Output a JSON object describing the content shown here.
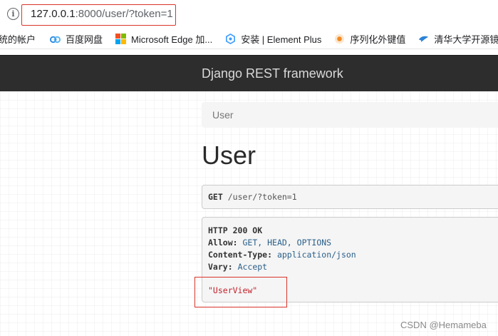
{
  "browser": {
    "url_host": "127.0.0.1",
    "url_rest": ":8000/user/?token=1"
  },
  "bookmarks": [
    {
      "label": "统的帐户",
      "icon": "account-icon"
    },
    {
      "label": "百度网盘",
      "icon": "baidu-netdisk-icon"
    },
    {
      "label": "Microsoft Edge 加...",
      "icon": "microsoft-icon"
    },
    {
      "label": "安装 | Element Plus",
      "icon": "element-plus-icon"
    },
    {
      "label": "序列化外键值",
      "icon": "orange-star-icon"
    },
    {
      "label": "清华大学开源镜像",
      "icon": "bird-icon"
    },
    {
      "label": "",
      "icon": "red-g-icon"
    }
  ],
  "navbar": {
    "brand": "Django REST framework"
  },
  "breadcrumb": {
    "current": "User"
  },
  "page": {
    "title": "User"
  },
  "request": {
    "method": "GET",
    "path": "/user/?token=1"
  },
  "response": {
    "status": "HTTP 200 OK",
    "headers": [
      {
        "key": "Allow:",
        "value": "GET, HEAD, OPTIONS"
      },
      {
        "key": "Content-Type:",
        "value": "application/json"
      },
      {
        "key": "Vary:",
        "value": "Accept"
      }
    ],
    "body": "\"UserView\""
  },
  "watermark": "CSDN @Hemameba",
  "colors": {
    "navbar_bg": "#2d2d2d",
    "annotation_red": "#d9342b",
    "json_string": "#c0232c",
    "header_value": "#2a5f8a"
  }
}
